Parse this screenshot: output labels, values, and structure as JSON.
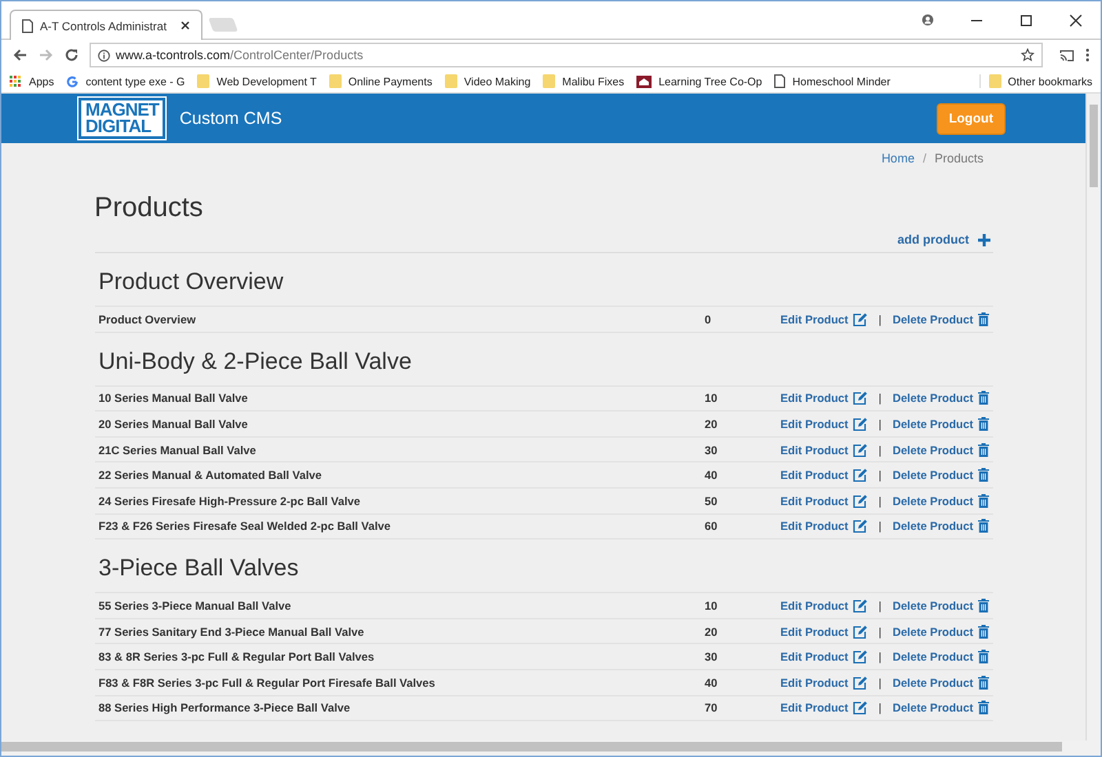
{
  "browser": {
    "tab_title": "A-T Controls Administrat",
    "url_host": "www.a-tcontrols.com",
    "url_path": "/ControlCenter/Products",
    "bookmarks": [
      {
        "kind": "apps",
        "label": "Apps"
      },
      {
        "kind": "google",
        "label": "content type exe - G"
      },
      {
        "kind": "folder",
        "label": "Web Development T"
      },
      {
        "kind": "folder",
        "label": "Online Payments"
      },
      {
        "kind": "folder",
        "label": "Video Making"
      },
      {
        "kind": "folder",
        "label": "Malibu Fixes"
      },
      {
        "kind": "site",
        "label": "Learning Tree Co-Op"
      },
      {
        "kind": "page",
        "label": "Homeschool Minder"
      }
    ],
    "other_bookmarks": "Other bookmarks"
  },
  "header": {
    "logo": [
      "MAGNET",
      "DIGITAL"
    ],
    "app_name": "Custom CMS",
    "logout": "Logout"
  },
  "breadcrumb": [
    {
      "label": "Home",
      "active": false
    },
    {
      "label": "Products",
      "active": true
    }
  ],
  "breadcrumb_separator": "/",
  "page_title": "Products",
  "add_product": "add product",
  "sections": [
    {
      "title": "Product Overview",
      "rows": [
        {
          "name": "Product Overview",
          "order": "0",
          "edit": "Edit Product",
          "sep": "|",
          "delete": "Delete Product"
        }
      ]
    },
    {
      "title": "Uni-Body & 2-Piece Ball Valve",
      "rows": [
        {
          "name": "10 Series Manual Ball Valve",
          "order": "10",
          "edit": "Edit Product",
          "sep": "|",
          "delete": "Delete Product"
        },
        {
          "name": "20 Series Manual Ball Valve",
          "order": "20",
          "edit": "Edit Product",
          "sep": "|",
          "delete": "Delete Product"
        },
        {
          "name": "21C Series Manual Ball Valve",
          "order": "30",
          "edit": "Edit Product",
          "sep": "|",
          "delete": "Delete Product"
        },
        {
          "name": "22 Series Manual & Automated Ball Valve",
          "order": "40",
          "edit": "Edit Product",
          "sep": "|",
          "delete": "Delete Product"
        },
        {
          "name": "24 Series Firesafe High-Pressure 2-pc Ball Valve",
          "order": "50",
          "edit": "Edit Product",
          "sep": "|",
          "delete": "Delete Product"
        },
        {
          "name": "F23 & F26 Series Firesafe Seal Welded 2-pc Ball Valve",
          "order": "60",
          "edit": "Edit Product",
          "sep": "|",
          "delete": "Delete Product"
        }
      ]
    },
    {
      "title": "3-Piece Ball Valves",
      "rows": [
        {
          "name": "55 Series 3-Piece Manual Ball Valve",
          "order": "10",
          "edit": "Edit Product",
          "sep": "|",
          "delete": "Delete Product"
        },
        {
          "name": "77 Series Sanitary End 3-Piece Manual Ball Valve",
          "order": "20",
          "edit": "Edit Product",
          "sep": "|",
          "delete": "Delete Product"
        },
        {
          "name": "83 & 8R Series 3-pc Full & Regular Port Ball Valves",
          "order": "30",
          "edit": "Edit Product",
          "sep": "|",
          "delete": "Delete Product"
        },
        {
          "name": "F83 & F8R Series 3-pc Full & Regular Port Firesafe Ball Valves",
          "order": "40",
          "edit": "Edit Product",
          "sep": "|",
          "delete": "Delete Product"
        },
        {
          "name": "88 Series High Performance 3-Piece Ball Valve",
          "order": "70",
          "edit": "Edit Product",
          "sep": "|",
          "delete": "Delete Product"
        }
      ]
    }
  ]
}
